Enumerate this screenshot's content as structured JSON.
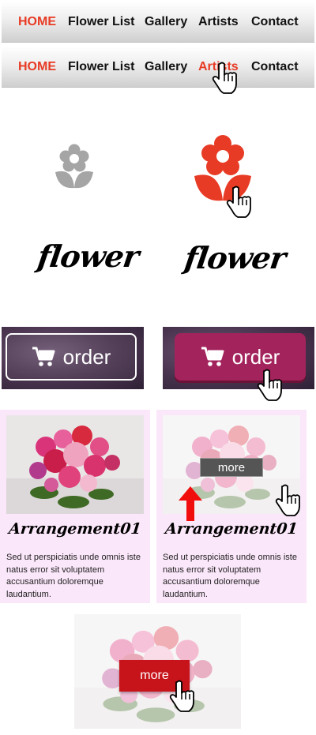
{
  "nav_normal": {
    "items": [
      "HOME",
      "Flower List",
      "Gallery",
      "Artists",
      "Contact"
    ],
    "active_index": 0
  },
  "nav_hover": {
    "items": [
      "HOME",
      "Flower List",
      "Gallery",
      "Artists",
      "Contact"
    ],
    "active_index": 0,
    "hover_index": 3
  },
  "logo": {
    "word": "flower",
    "icon_color_default": "#a5a5a5",
    "icon_color_hover": "#e83b25"
  },
  "order": {
    "label": "order",
    "icon": "cart-icon",
    "hover_color": "#a3235c"
  },
  "cards": [
    {
      "title": "Arrangement01",
      "text": "Sed ut perspiciatis unde omnis iste natus error sit voluptatem accusantium doloremque laudantium.",
      "state": "default"
    },
    {
      "title": "Arrangement01",
      "text": "Sed ut perspiciatis unde omnis iste natus error sit voluptatem accusantium doloremque laudantium.",
      "state": "hover",
      "overlay_label": "more",
      "indicator_icon": "arrow-up-icon"
    }
  ],
  "standalone": {
    "more_label": "more",
    "button_color": "#c7141b"
  },
  "colors": {
    "accent_red": "#e83b25",
    "card_bg": "#fbe7fa"
  }
}
